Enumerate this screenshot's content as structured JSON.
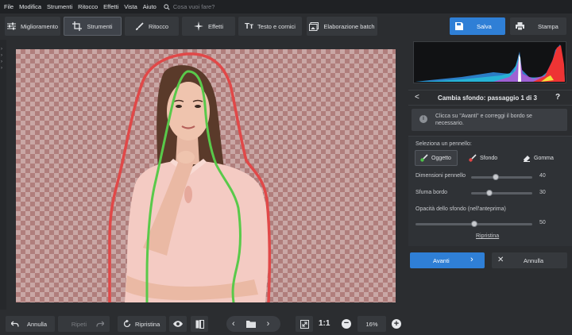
{
  "menu": [
    "File",
    "Modifica",
    "Strumenti",
    "Ritocco",
    "Effetti",
    "Vista",
    "Aiuto"
  ],
  "search": {
    "placeholder": "Cosa vuoi fare?"
  },
  "toolbar": {
    "tabs": [
      {
        "label": "Miglioramento",
        "icon": "sliders-icon"
      },
      {
        "label": "Strumenti",
        "icon": "crop-icon",
        "active": true
      },
      {
        "label": "Ritocco",
        "icon": "brush-icon"
      },
      {
        "label": "Effetti",
        "icon": "sparkle-icon"
      },
      {
        "label": "Testo e cornici",
        "icon": "text-icon"
      },
      {
        "label": "Elaborazione batch",
        "icon": "batch-icon"
      }
    ],
    "save_label": "Salva",
    "print_label": "Stampa"
  },
  "step": {
    "title": "Cambia sfondo: passaggio 1 di 3",
    "back": "<",
    "help": "?"
  },
  "hint": {
    "text": "Clicca su \"Avanti\" e correggi il bordo se necessario.",
    "icon": "i"
  },
  "brush": {
    "section_label": "Seleziona un pennello:",
    "buttons": [
      {
        "label": "Oggetto",
        "icon": "object-brush-icon",
        "color": "#4fc24a",
        "active": true
      },
      {
        "label": "Sfondo",
        "icon": "background-brush-icon",
        "color": "#e24646"
      },
      {
        "label": "Gomma",
        "icon": "eraser-icon"
      }
    ],
    "sliders": [
      {
        "label": "Dimensioni pennello",
        "value": 40,
        "max": 100
      },
      {
        "label": "Sfuma bordo",
        "value": 30,
        "max": 100
      },
      {
        "label": "Opacità dello sfondo (nell'anteprima)",
        "value": 50,
        "max": 100
      }
    ],
    "reset_label": "Ripristina"
  },
  "actions": {
    "next_label": "Avanti",
    "cancel_label": "Annulla"
  },
  "bottom": {
    "undo_label": "Annulla",
    "redo_label": "Ripeti",
    "reset_label": "Ripristina",
    "ratio_label": "1:1",
    "zoom_value": "16%"
  },
  "colors": {
    "accent": "#2f7fd6",
    "object_stroke": "#59c94a",
    "background_stroke": "#e04848"
  }
}
